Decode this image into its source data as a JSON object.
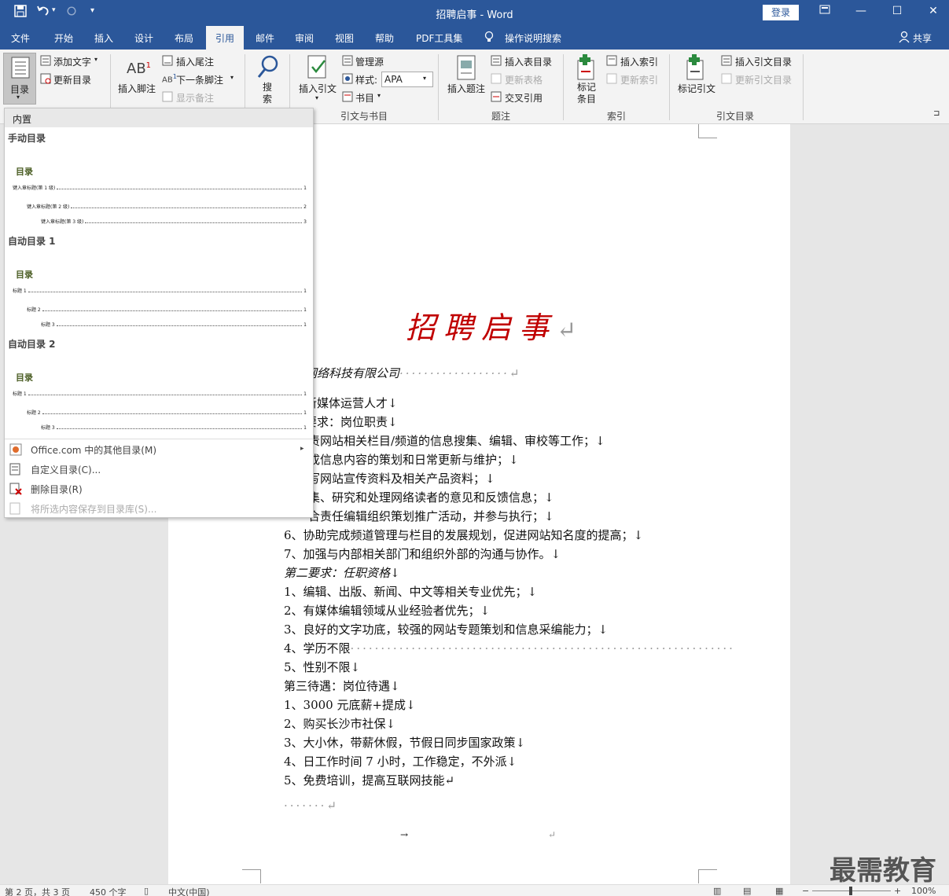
{
  "window": {
    "title": "招聘启事  -  Word",
    "login_label": "登录",
    "quick_access_icons": [
      "save-icon",
      "undo-icon",
      "redo-icon",
      "customize-icon"
    ]
  },
  "tabs": [
    {
      "label": "文件"
    },
    {
      "label": "开始"
    },
    {
      "label": "插入"
    },
    {
      "label": "设计"
    },
    {
      "label": "布局"
    },
    {
      "label": "引用",
      "active": true
    },
    {
      "label": "邮件"
    },
    {
      "label": "审阅"
    },
    {
      "label": "视图"
    },
    {
      "label": "帮助"
    },
    {
      "label": "PDF工具集"
    },
    {
      "label": "操作说明搜索"
    }
  ],
  "share_label": "共享",
  "ribbon": {
    "toc_button": "目录",
    "add_text": "添加文字",
    "update_table": "更新目录",
    "insert_footnote": "插入脚注",
    "insert_endnote": "插入尾注",
    "next_footnote": "下一条脚注",
    "show_notes": "显示备注",
    "search": "搜索",
    "insert_citation": "插入引文",
    "manage_sources": "管理源",
    "style_label": "样式:",
    "style_value": "APA",
    "bibliography": "书目",
    "group_citations": "引文与书目",
    "insert_caption": "插入题注",
    "insert_table_of_figures": "插入表目录",
    "update_table_figures": "更新表格",
    "cross_reference": "交叉引用",
    "group_captions": "题注",
    "mark_entry": "标记条目",
    "insert_index": "插入索引",
    "update_index": "更新索引",
    "group_index": "索引",
    "mark_citation": "标记引文",
    "insert_table_of_authorities": "插入引文目录",
    "update_table_authorities": "更新引文目录",
    "group_authorities": "引文目录"
  },
  "dropdown": {
    "header": "内置",
    "sections": [
      {
        "title": "手动目录",
        "heading": "目录",
        "lines": [
          {
            "label": "键入章标题(第 1 级)",
            "page": "1"
          },
          {
            "label": "键入章标题(第 2 级)",
            "page": "2"
          },
          {
            "label": "键入章标题(第 3 级)",
            "page": "3"
          }
        ]
      },
      {
        "title": "自动目录 1",
        "heading": "目录",
        "lines": [
          {
            "label": "标题 1",
            "page": "1"
          },
          {
            "label": "标题 2",
            "page": "1"
          },
          {
            "label": "标题 3",
            "page": "1"
          }
        ]
      },
      {
        "title": "自动目录 2",
        "heading": "目录",
        "lines": [
          {
            "label": "标题 1",
            "page": "1"
          },
          {
            "label": "标题 2",
            "page": "1"
          },
          {
            "label": "标题 3",
            "page": "1"
          }
        ]
      }
    ],
    "menu": [
      {
        "label": "Office.com 中的其他目录(M)",
        "enabled": true
      },
      {
        "label": "自定义目录(C)...",
        "enabled": true
      },
      {
        "label": "删除目录(R)",
        "enabled": true
      },
      {
        "label": "将所选内容保存到目录库(S)...",
        "enabled": false
      }
    ]
  },
  "document": {
    "title": "招聘启事",
    "company": "网络科技有限公司",
    "lines": [
      "新媒体运营人才↓",
      "要求：岗位职责↓",
      "责网站相关栏目/频道的信息搜集、编辑、审校等工作；↓",
      "成信息内容的策划和日常更新与维护；↓",
      "写网站宣传资料及相关产品资料；↓",
      "集、研究和处理网络读者的意见和反馈信息；↓",
      "合责任编辑组织策划推广活动，并参与执行；↓",
      "6、协助完成频道管理与栏目的发展规划，促进网站知名度的提高；↓",
      "7、加强与内部相关部门和组织外部的沟通与协作。↓",
      "第二要求：任职资格↓",
      "1、编辑、出版、新闻、中文等相关专业优先；↓",
      "2、有媒体编辑领域从业经验者优先；↓",
      "3、良好的文字功底，较强的网站专题策划和信息采编能力；↓",
      "4、学历不限",
      "5、性别不限↓",
      "第三待遇：岗位待遇↓",
      "1、3000 元底薪+提成↓",
      "2、购买长沙市社保↓",
      "3、大小休，带薪休假，节假日同步国家政策↓",
      "4、日工作时间 7 小时，工作稳定，不外派↓",
      "5、免费培训，提高互联网技能↵"
    ],
    "end_mark": "↵",
    "tab_mark": "→"
  },
  "status": {
    "page": "第 2 页，共 3 页",
    "words": "450 个字",
    "language": "中文(中国)",
    "zoom": "100%"
  },
  "watermark": "最需教育"
}
